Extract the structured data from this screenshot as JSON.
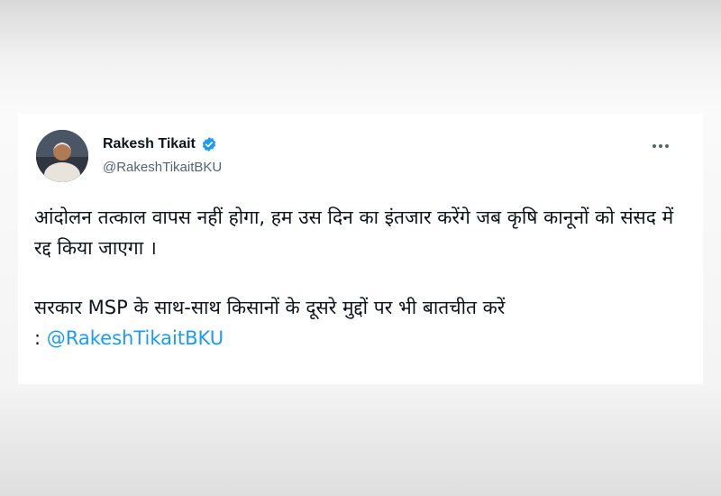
{
  "tweet": {
    "author": {
      "display_name": "Rakesh Tikait",
      "handle": "@RakeshTikaitBKU",
      "verified": true
    },
    "colors": {
      "mention": "#1d9bf0",
      "verified_badge": "#1d9bf0",
      "text": "#0f1419",
      "secondary": "#536471"
    },
    "body": {
      "paragraph_1": "आंदोलन तत्काल वापस नहीं होगा, हम उस दिन का इंतजार करेंगे जब कृषि कानूनों को संसद में रद्द किया जाएगा ।",
      "paragraph_2": "सरकार MSP के साथ-साथ किसानों के दूसरे मुद्दों पर भी बातचीत करें",
      "paragraph_2_prefix": ": ",
      "mention": "@RakeshTikaitBKU"
    },
    "icons": {
      "more": "more-horizontal-icon",
      "verified": "verified-badge-icon"
    }
  }
}
